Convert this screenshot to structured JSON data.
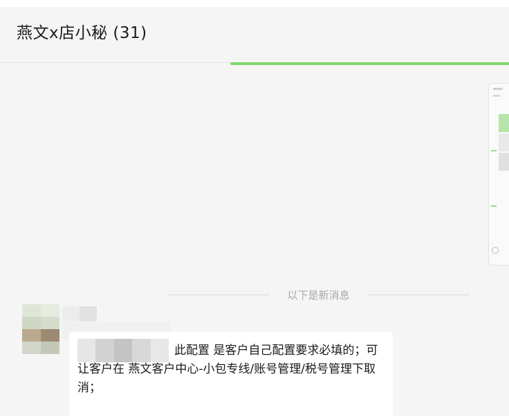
{
  "chat": {
    "title": "燕文x店小秘 (31)"
  },
  "divider": {
    "new_messages_label": "以下是新消息"
  },
  "message": {
    "text": "此配置 是客户自己配置要求必填的；可让客户在 燕文客户中心-小包专线/账号管理/税号管理下取消；"
  },
  "colors": {
    "accent_green": "#7ed96a",
    "window_bg": "#f5f5f5",
    "bubble_bg": "#ffffff"
  },
  "icons": {
    "attachment_preview": "screenshot-thumbnail"
  }
}
